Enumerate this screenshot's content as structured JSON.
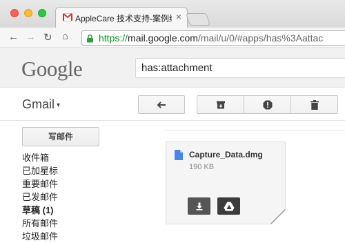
{
  "browser": {
    "tab": {
      "title": "AppleCare 技术支持-案例编号",
      "close_glyph": "×",
      "favicon": "gmail-icon"
    },
    "nav": {
      "back_glyph": "←",
      "forward_glyph": "→",
      "reload_glyph": "↻",
      "home_glyph": "⌂"
    },
    "url": {
      "scheme": "https://",
      "host": "mail.google.com",
      "path": "/mail/u/0/#apps/has%3Aattac"
    }
  },
  "gmail": {
    "logo": "Google",
    "search": {
      "value": "has:attachment"
    },
    "app_label": "Gmail",
    "app_label_caret": "▾",
    "toolbar_icons": [
      "reply-icon",
      "archive-icon",
      "report-spam-icon",
      "delete-icon"
    ],
    "compose_label": "写邮件",
    "nav_items": [
      {
        "label": "收件箱"
      },
      {
        "label": "已加星标"
      },
      {
        "label": "重要邮件"
      },
      {
        "label": "已发邮件"
      },
      {
        "label": "草稿 (1)",
        "bold": true
      },
      {
        "label": "所有邮件"
      },
      {
        "label": "垃圾邮件"
      }
    ],
    "attachment": {
      "file_name": "Capture_Data.dmg",
      "file_size": "190 KB",
      "actions": [
        "download-icon",
        "google-drive-icon"
      ]
    }
  },
  "colors": {
    "url_scheme": "#078a1f",
    "file_icon": "#4a86e8",
    "gmail_red": "#d93025"
  }
}
